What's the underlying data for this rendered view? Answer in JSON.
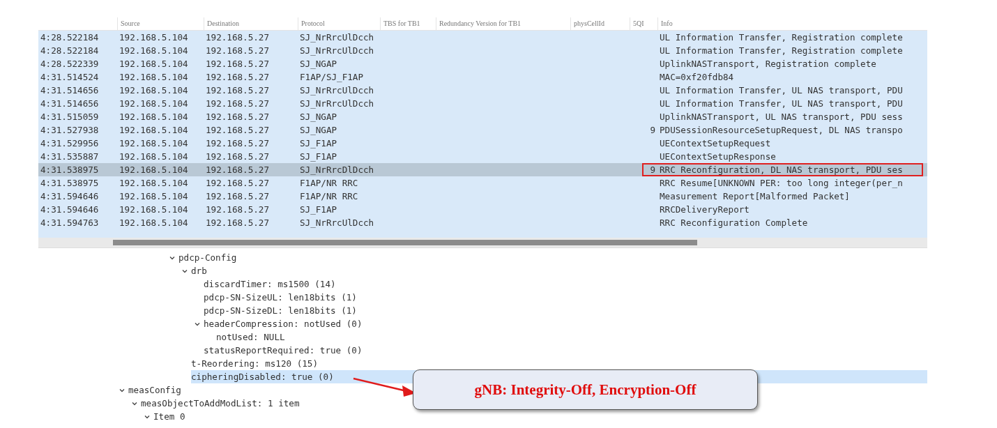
{
  "packet_list": {
    "columns": [
      {},
      {
        "label": "Source"
      },
      {
        "label": "Destination"
      },
      {
        "label": "Protocol"
      },
      {
        "label": "TBS for TB1"
      },
      {
        "label": "Redundancy Version for TB1"
      },
      {
        "label": "physCellId"
      },
      {
        "label": "5QI"
      },
      {
        "label": "Info"
      }
    ],
    "rows": [
      {
        "time": "4:28.522184",
        "source": "192.168.5.104",
        "destination": "192.168.5.27",
        "protocol": "SJ_NrRrcUlDcch",
        "info": "UL Information Transfer, Registration complete",
        "selected": false,
        "highlighted": false
      },
      {
        "time": "4:28.522184",
        "source": "192.168.5.104",
        "destination": "192.168.5.27",
        "protocol": "SJ_NrRrcUlDcch",
        "info": "UL Information Transfer, Registration complete",
        "selected": false,
        "highlighted": false
      },
      {
        "time": "4:28.522339",
        "source": "192.168.5.104",
        "destination": "192.168.5.27",
        "protocol": "SJ_NGAP",
        "info": "UplinkNASTransport, Registration complete",
        "selected": false,
        "highlighted": false
      },
      {
        "time": "4:31.514524",
        "source": "192.168.5.104",
        "destination": "192.168.5.27",
        "protocol": "F1AP/SJ_F1AP",
        "info": " MAC=0xf20fdb84",
        "selected": false,
        "highlighted": false
      },
      {
        "time": "4:31.514656",
        "source": "192.168.5.104",
        "destination": "192.168.5.27",
        "protocol": "SJ_NrRrcUlDcch",
        "info": "UL Information Transfer, UL NAS transport, PDU",
        "selected": false,
        "highlighted": false
      },
      {
        "time": "4:31.514656",
        "source": "192.168.5.104",
        "destination": "192.168.5.27",
        "protocol": "SJ_NrRrcUlDcch",
        "info": "UL Information Transfer, UL NAS transport, PDU",
        "selected": false,
        "highlighted": false
      },
      {
        "time": "4:31.515059",
        "source": "192.168.5.104",
        "destination": "192.168.5.27",
        "protocol": "SJ_NGAP",
        "info": "UplinkNASTransport, UL NAS transport, PDU sess",
        "selected": false,
        "highlighted": false
      },
      {
        "time": "4:31.527938",
        "source": "192.168.5.104",
        "destination": "192.168.5.27",
        "protocol": "SJ_NGAP",
        "qi": "9",
        "info": "PDUSessionResourceSetupRequest, DL NAS transpo",
        "selected": false,
        "highlighted": false
      },
      {
        "time": "4:31.529956",
        "source": "192.168.5.104",
        "destination": "192.168.5.27",
        "protocol": "SJ_F1AP",
        "info": "UEContextSetupRequest",
        "selected": false,
        "highlighted": false
      },
      {
        "time": "4:31.535887",
        "source": "192.168.5.104",
        "destination": "192.168.5.27",
        "protocol": "SJ_F1AP",
        "info": "UEContextSetupResponse",
        "selected": false,
        "highlighted": false
      },
      {
        "time": "4:31.538975",
        "source": "192.168.5.104",
        "destination": "192.168.5.27",
        "protocol": "SJ_NrRrcDlDcch",
        "qi": "9",
        "info": "RRC Reconfiguration, DL NAS transport, PDU ses",
        "selected": true,
        "highlighted": true
      },
      {
        "time": "4:31.538975",
        "source": "192.168.5.104",
        "destination": "192.168.5.27",
        "protocol": "F1AP/NR RRC",
        "info": "RRC Resume[UNKNOWN PER: too long integer(per_n",
        "selected": false,
        "highlighted": false
      },
      {
        "time": "4:31.594646",
        "source": "192.168.5.104",
        "destination": "192.168.5.27",
        "protocol": "F1AP/NR RRC",
        "info": "Measurement Report[Malformed Packet]",
        "selected": false,
        "highlighted": false
      },
      {
        "time": "4:31.594646",
        "source": "192.168.5.104",
        "destination": "192.168.5.27",
        "protocol": "SJ_F1AP",
        "info": "RRCDeliveryReport",
        "selected": false,
        "highlighted": false
      },
      {
        "time": "4:31.594763",
        "source": "192.168.5.104",
        "destination": "192.168.5.27",
        "protocol": "SJ_NrRrcUlDcch",
        "info": "RRC Reconfiguration Complete",
        "selected": false,
        "highlighted": false
      }
    ]
  },
  "detail_tree": [
    {
      "children": [
        {
          "children": [
            {
              "children": [
                {
                  "children": [
                    {
                      "label": "pdcp-Config",
                      "expanded": true,
                      "selected": false,
                      "children": [
                        {
                          "label": "drb",
                          "expanded": true,
                          "selected": false,
                          "children": [
                            {
                              "label": "discardTimer: ms1500 (14)",
                              "selected": false
                            },
                            {
                              "label": "pdcp-SN-SizeUL: len18bits (1)",
                              "selected": false
                            },
                            {
                              "label": "pdcp-SN-SizeDL: len18bits (1)",
                              "selected": false
                            },
                            {
                              "label": "headerCompression: notUsed (0)",
                              "expanded": true,
                              "selected": false,
                              "children": [
                                {
                                  "label": "notUsed: NULL",
                                  "selected": false
                                }
                              ]
                            },
                            {
                              "label": "statusReportRequired: true (0)",
                              "selected": false
                            }
                          ]
                        },
                        {
                          "label": "t-Reordering: ms120 (15)",
                          "selected": false
                        },
                        {
                          "label": "cipheringDisabled: true (0)",
                          "selected": true
                        }
                      ]
                    }
                  ]
                }
              ]
            }
          ]
        }
      ]
    },
    {
      "label": "measConfig",
      "expanded": true,
      "selected": false,
      "children": [
        {
          "label": "measObjectToAddModList: 1 item",
          "expanded": true,
          "selected": false,
          "children": [
            {
              "label": "Item 0",
              "expanded": true,
              "selected": false
            }
          ]
        }
      ]
    }
  ],
  "callout": {
    "text": "gNB: Integrity-Off, Encryption-Off"
  }
}
